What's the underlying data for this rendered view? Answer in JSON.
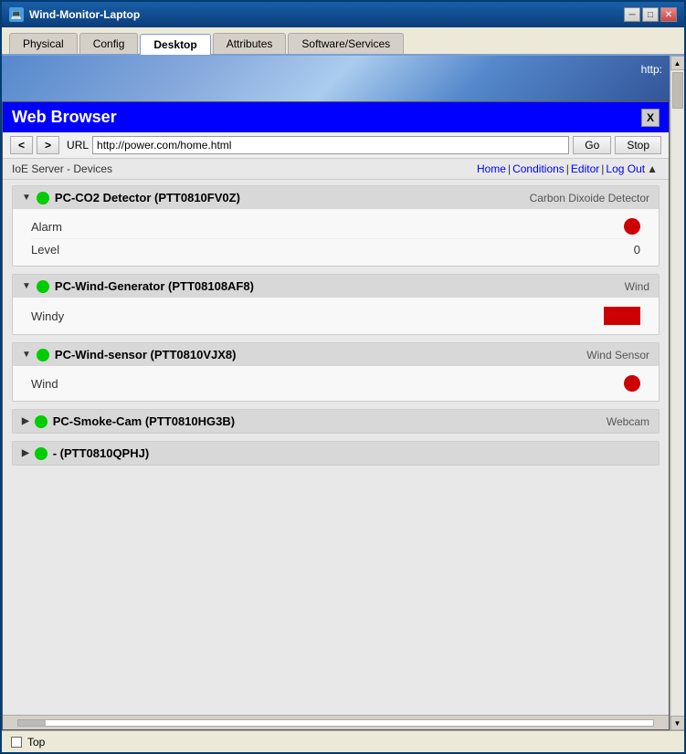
{
  "window": {
    "title": "Wind-Monitor-Laptop",
    "controls": {
      "minimize": "─",
      "maximize": "□",
      "close": "✕"
    }
  },
  "tabs": [
    {
      "label": "Physical",
      "active": false
    },
    {
      "label": "Config",
      "active": false
    },
    {
      "label": "Desktop",
      "active": true
    },
    {
      "label": "Attributes",
      "active": false
    },
    {
      "label": "Software/Services",
      "active": false
    }
  ],
  "browser": {
    "title": "Web Browser",
    "close_label": "X",
    "nav": {
      "back": "<",
      "forward": ">",
      "url_label": "URL",
      "url_value": "http://power.com/home.html",
      "go_label": "Go",
      "stop_label": "Stop"
    },
    "ioe": {
      "server_text": "IoE Server - Devices",
      "nav_home": "Home",
      "nav_sep1": "|",
      "nav_conditions": "Conditions",
      "nav_sep2": "|",
      "nav_editor": "Editor",
      "nav_sep3": "|",
      "nav_logout": "Log Out",
      "nav_arrow": "▲"
    }
  },
  "devices": [
    {
      "id": "co2",
      "name": "PC-CO2 Detector (PTT0810FV0Z)",
      "type": "Carbon Dixoide Detector",
      "status_color": "green",
      "expanded": true,
      "rows": [
        {
          "label": "Alarm",
          "value_type": "red-circle"
        },
        {
          "label": "Level",
          "value_text": "0",
          "value_type": "text"
        }
      ]
    },
    {
      "id": "wind-gen",
      "name": "PC-Wind-Generator (PTT08108AF8)",
      "type": "Wind",
      "status_color": "green",
      "expanded": true,
      "rows": [
        {
          "label": "Windy",
          "value_type": "red-rect"
        }
      ]
    },
    {
      "id": "wind-sensor",
      "name": "PC-Wind-sensor (PTT0810VJX8)",
      "type": "Wind Sensor",
      "status_color": "green",
      "expanded": true,
      "rows": [
        {
          "label": "Wind",
          "value_type": "red-circle"
        }
      ]
    },
    {
      "id": "smoke-cam",
      "name": "PC-Smoke-Cam (PTT0810HG3B)",
      "type": "Webcam",
      "status_color": "green",
      "expanded": false,
      "rows": []
    },
    {
      "id": "unknown",
      "name": "- (PTT0810QPHJ)",
      "type": "",
      "status_color": "green",
      "expanded": false,
      "rows": []
    }
  ],
  "status_bar": {
    "label": "Top"
  }
}
